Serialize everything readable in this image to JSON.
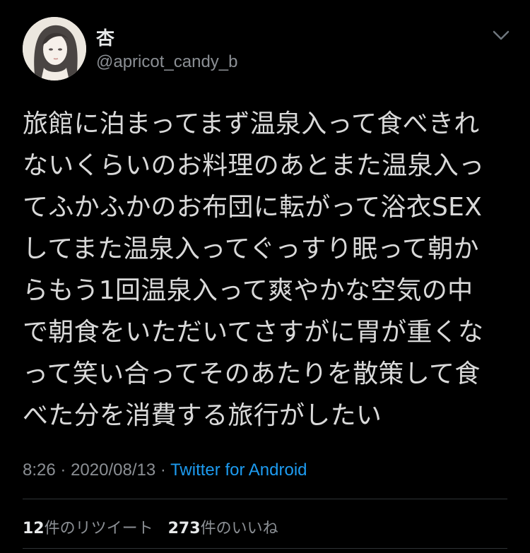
{
  "user": {
    "display_name": "杏",
    "handle": "@apricot_candy_b"
  },
  "tweet": {
    "lines": [
      "旅館に泊まってまず温泉入って食べきれ",
      "ないくらいのお料理のあとまた温泉入っ",
      "てふかふかのお布団に転がって浴衣SEX",
      "してまた温泉入ってぐっすり眠って朝か",
      "らもう1回温泉入って爽やかな空気の中",
      "で朝食をいただいてさすがに胃が重くな",
      "って笑い合ってそのあたりを散策して食",
      "べた分を消費する旅行がしたい"
    ],
    "time": "8:26",
    "separator": "·",
    "date": "2020/08/13",
    "source": "Twitter for Android"
  },
  "stats": {
    "retweets_count": "12",
    "retweets_label": "件のリツイート",
    "likes_count": "273",
    "likes_label": "件のいいね"
  },
  "icons": {
    "menu": "chevron-down-icon"
  }
}
